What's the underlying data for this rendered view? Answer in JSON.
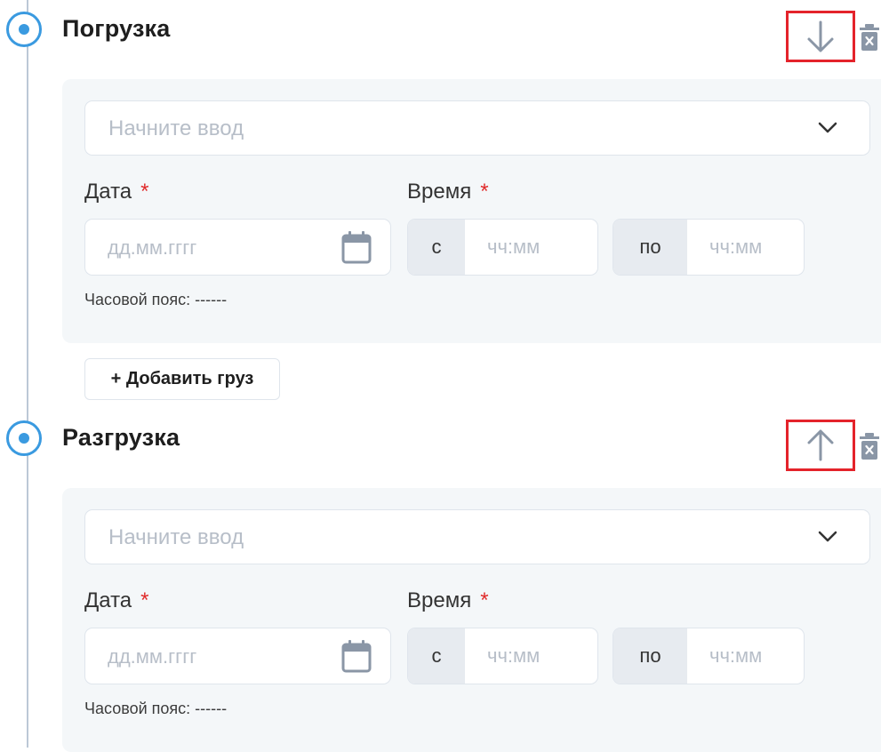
{
  "stops": [
    {
      "title": "Погрузка",
      "move_icon": "arrow-down-icon",
      "delete_icon": "trash-icon",
      "address_placeholder": "Начните ввод",
      "date_label": "Дата",
      "required_mark": "*",
      "date_placeholder": "дд.мм.гггг",
      "time_label": "Время",
      "time_from_prefix": "с",
      "time_from_placeholder": "чч:мм",
      "time_to_prefix": "по",
      "time_to_placeholder": "чч:мм",
      "timezone": "Часовой пояс: ------"
    },
    {
      "title": "Разгрузка",
      "move_icon": "arrow-up-icon",
      "delete_icon": "trash-icon",
      "address_placeholder": "Начните ввод",
      "date_label": "Дата",
      "required_mark": "*",
      "date_placeholder": "дд.мм.гггг",
      "time_label": "Время",
      "time_from_prefix": "с",
      "time_from_placeholder": "чч:мм",
      "time_to_prefix": "по",
      "time_to_placeholder": "чч:мм",
      "timezone": "Часовой пояс: ------"
    }
  ],
  "add_cargo_label": "+ Добавить груз",
  "colors": {
    "accent": "#3a9ae0",
    "highlight_frame": "#e4232b",
    "required": "#e02a2a",
    "card_bg": "#f4f7f9",
    "timeline": "#bcc8d6"
  }
}
